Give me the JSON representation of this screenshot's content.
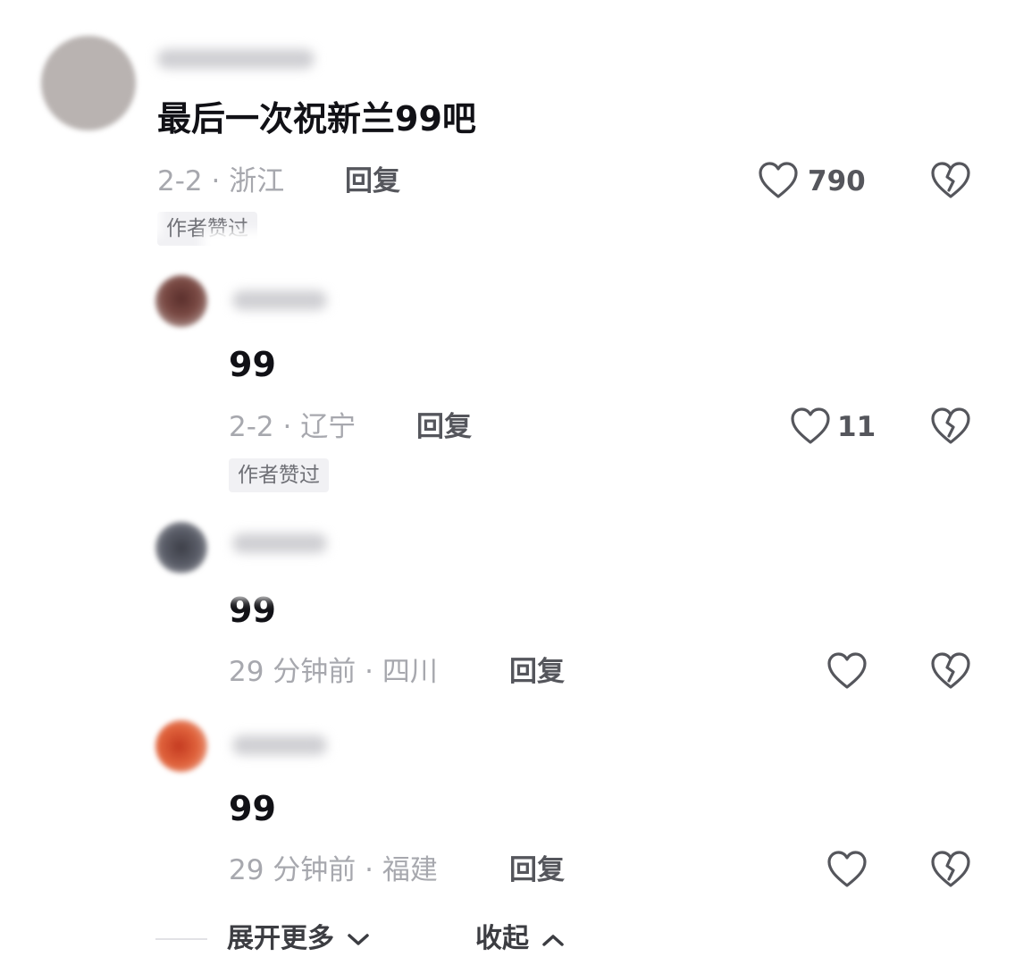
{
  "comments": [
    {
      "text": "最后一次祝新兰99吧",
      "meta": "2-2 · 浙江",
      "reply_label": "回复",
      "like_count": "790",
      "badge": "作者赞过"
    },
    {
      "text": "99",
      "meta": "2-2 · 辽宁",
      "reply_label": "回复",
      "like_count": "11",
      "badge": "作者赞过"
    },
    {
      "text": "99",
      "meta": "29 分钟前 · 四川",
      "reply_label": "回复",
      "like_count": ""
    },
    {
      "text": "99",
      "meta": "29 分钟前 · 福建",
      "reply_label": "回复",
      "like_count": ""
    }
  ],
  "footer": {
    "expand_label": "展开更多",
    "collapse_label": "收起"
  },
  "icons": {
    "like": "heart-outline-icon",
    "dislike": "broken-heart-icon",
    "expand": "chevron-down-icon",
    "collapse": "chevron-up-icon"
  },
  "colors": {
    "text_primary": "#111116",
    "meta_gray": "#a7a8ae",
    "action_gray": "#55565c",
    "badge_bg": "#f1f1f4"
  }
}
